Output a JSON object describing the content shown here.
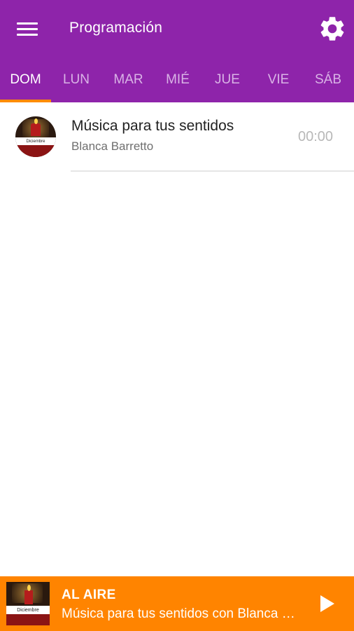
{
  "header": {
    "title": "Programación",
    "menu_icon": "menu-icon",
    "settings_icon": "gear-icon",
    "background": "#8e24aa"
  },
  "tabs": [
    {
      "label": "DOM",
      "active": true
    },
    {
      "label": "LUN",
      "active": false
    },
    {
      "label": "MAR",
      "active": false
    },
    {
      "label": "MIÉ",
      "active": false
    },
    {
      "label": "JUE",
      "active": false
    },
    {
      "label": "VIE",
      "active": false
    },
    {
      "label": "SÁB",
      "active": false
    }
  ],
  "schedule": [
    {
      "title": "Música para tus sentidos",
      "host": "Blanca Barretto",
      "time": "00:00",
      "thumb_caption": "Diciembre"
    }
  ],
  "player": {
    "status_label": "AL AIRE",
    "now_playing": "Música para tus sentidos con Blanca Barretto",
    "thumb_caption": "Diciembre",
    "play_icon": "play-icon",
    "background": "#ff8400"
  },
  "colors": {
    "accent": "#ff8c00",
    "primary": "#8e24aa"
  }
}
